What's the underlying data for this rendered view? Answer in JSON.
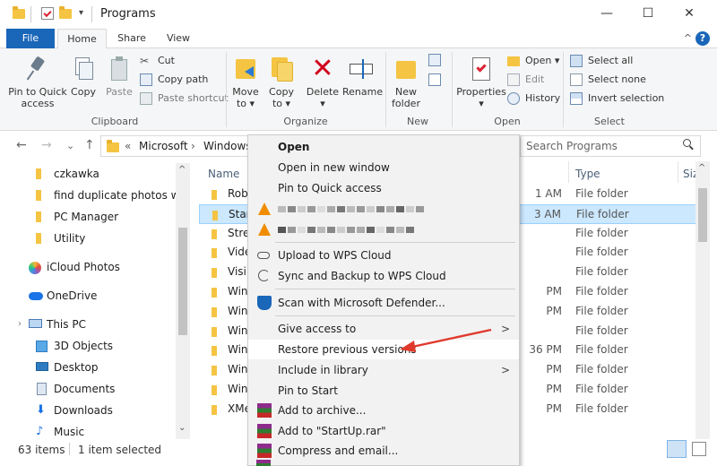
{
  "titlebar": {
    "title": "Programs",
    "quick_menu_arrow": "▾",
    "buttons": {
      "minimize": "—",
      "maximize": "☐",
      "close": "✕"
    }
  },
  "tabs": {
    "file": "File",
    "home": "Home",
    "share": "Share",
    "view": "View",
    "collapse": "^",
    "help": "?"
  },
  "ribbon": {
    "clipboard": {
      "group_label": "Clipboard",
      "pin_label_1": "Pin to Quick",
      "pin_label_2": "access",
      "copy": "Copy",
      "paste": "Paste",
      "cut": "Cut",
      "copy_path": "Copy path",
      "paste_shortcut": "Paste shortcut"
    },
    "organize": {
      "group_label": "Organize",
      "move_to_1": "Move",
      "move_to_2": "to ▾",
      "copy_to_1": "Copy",
      "copy_to_2": "to ▾",
      "delete": "Delete",
      "delete_arrow": "▾",
      "rename": "Rename"
    },
    "new": {
      "group_label": "New",
      "new_folder_1": "New",
      "new_folder_2": "folder"
    },
    "open": {
      "group_label": "Open",
      "properties": "Properties",
      "properties_arrow": "▾",
      "open": "Open ▾",
      "edit": "Edit",
      "history": "History"
    },
    "select": {
      "group_label": "Select",
      "select_all": "Select all",
      "select_none": "Select none",
      "invert": "Invert selection"
    }
  },
  "address": {
    "back": "←",
    "forward": "→",
    "history": "⌄",
    "up": "↑",
    "crumb_sep": "«",
    "crumbs": [
      "Microsoft",
      "Windows"
    ],
    "search_placeholder": "Search Programs",
    "search_icon": "magnifier-icon"
  },
  "sidebar": {
    "items": [
      {
        "label": "czkawka",
        "icon": "folder-icon"
      },
      {
        "label": "find duplicate photos win",
        "icon": "folder-icon"
      },
      {
        "label": "PC Manager",
        "icon": "folder-icon"
      },
      {
        "label": "Utility",
        "icon": "folder-icon"
      },
      {
        "label": "iCloud Photos",
        "icon": "icloud-photos-icon"
      },
      {
        "label": "OneDrive",
        "icon": "cloud-icon"
      },
      {
        "label": "This PC",
        "icon": "computer-icon"
      },
      {
        "label": "3D Objects",
        "icon": "cube-icon"
      },
      {
        "label": "Desktop",
        "icon": "desktop-icon"
      },
      {
        "label": "Documents",
        "icon": "document-icon"
      },
      {
        "label": "Downloads",
        "icon": "download-icon"
      },
      {
        "label": "Music",
        "icon": "music-icon"
      }
    ],
    "expand_arrow": "›",
    "scroll_up": "^",
    "scroll_down": "⌄"
  },
  "list": {
    "columns": {
      "name": "Name",
      "type": "Type",
      "size": "Siz"
    },
    "rows": [
      {
        "name": "Rob",
        "date": "1 AM",
        "type": "File folder"
      },
      {
        "name": "Star",
        "date": "3 AM",
        "type": "File folder",
        "selected": true
      },
      {
        "name": "Stre",
        "date": "",
        "type": "File folder"
      },
      {
        "name": "Vide",
        "date": "",
        "type": "File folder"
      },
      {
        "name": "Visi",
        "date": "",
        "type": "File folder"
      },
      {
        "name": "Win",
        "date": "PM",
        "type": "File folder"
      },
      {
        "name": "Win",
        "date": "PM",
        "type": "File folder"
      },
      {
        "name": "Win",
        "date": "",
        "type": "File folder"
      },
      {
        "name": "Win",
        "date": "36 PM",
        "type": "File folder"
      },
      {
        "name": "Win",
        "date": "PM",
        "type": "File folder"
      },
      {
        "name": "Win",
        "date": "PM",
        "type": "File folder"
      },
      {
        "name": "XMe",
        "date": "PM",
        "type": "File folder"
      }
    ]
  },
  "status": {
    "count": "63 items",
    "selected": "1 item selected"
  },
  "context_menu": {
    "open": "Open",
    "open_new_window": "Open in new window",
    "pin_quick": "Pin to Quick access",
    "upload_wps": "Upload to WPS Cloud",
    "sync_wps": "Sync and Backup to WPS Cloud",
    "defender": "Scan with Microsoft Defender...",
    "give_access": "Give access to",
    "restore": "Restore previous versions",
    "include_library": "Include in library",
    "pin_start": "Pin to Start",
    "add_archive": "Add to archive...",
    "add_rar": "Add to \"StartUp.rar\"",
    "compress_email": "Compress and email...",
    "submenu_arrow": ">"
  },
  "colors": {
    "accent": "#1a66b8",
    "selection": "#cce8ff",
    "annotation_arrow": "#e03a2c",
    "folder": "#f4c442"
  }
}
